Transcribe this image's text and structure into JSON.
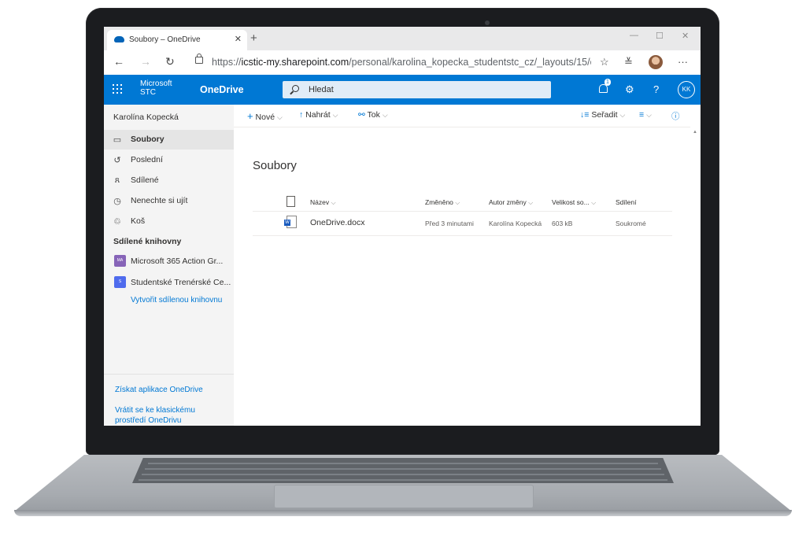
{
  "browser": {
    "tab_title": "Soubory – OneDrive",
    "url_prefix": "https://",
    "url_host": "icstic-my.sharepoint.com",
    "url_path": "/personal/karolina_kopecka_studentstc_cz/_layouts/15/one..."
  },
  "suitebar": {
    "org_line1": "Microsoft",
    "org_line2": "STC",
    "app_name": "OneDrive",
    "search_placeholder": "Hledat",
    "notification_count": "1",
    "user_initials": "KK",
    "accent_color": "#0078d4"
  },
  "leftnav": {
    "user_name": "Karolína Kopecká",
    "items": [
      {
        "label": "Soubory",
        "icon": "folder-icon",
        "selected": true
      },
      {
        "label": "Poslední",
        "icon": "history-icon"
      },
      {
        "label": "Sdílené",
        "icon": "people-icon"
      },
      {
        "label": "Nenechte si ujít",
        "icon": "clock-icon"
      },
      {
        "label": "Koš",
        "icon": "recycle-bin-icon"
      }
    ],
    "libraries_heading": "Sdílené knihovny",
    "libraries": [
      {
        "label": "Microsoft 365 Action Gr...",
        "initials": "MA",
        "color": "#8764b8"
      },
      {
        "label": "Studentské Trenérské Ce...",
        "initials": "S",
        "color": "#4f6bed"
      }
    ],
    "create_library": "Vytvořit sdílenou knihovnu",
    "get_apps": "Získat aplikace OneDrive",
    "classic_link_line1": "Vrátit se ke klasickému",
    "classic_link_line2": "prostředí OneDrivu"
  },
  "commands": {
    "new": "Nové",
    "upload": "Nahrát",
    "flow": "Tok",
    "sort": "Seřadit"
  },
  "main": {
    "title": "Soubory",
    "columns": [
      "Název",
      "Změněno",
      "Autor změny",
      "Velikost so...",
      "Sdílení"
    ],
    "files": [
      {
        "name": "OneDrive.docx",
        "modified": "Před 3 minutami",
        "modified_by": "Karolína Kopecká",
        "size": "603 kB",
        "sharing": "Soukromé"
      }
    ]
  }
}
